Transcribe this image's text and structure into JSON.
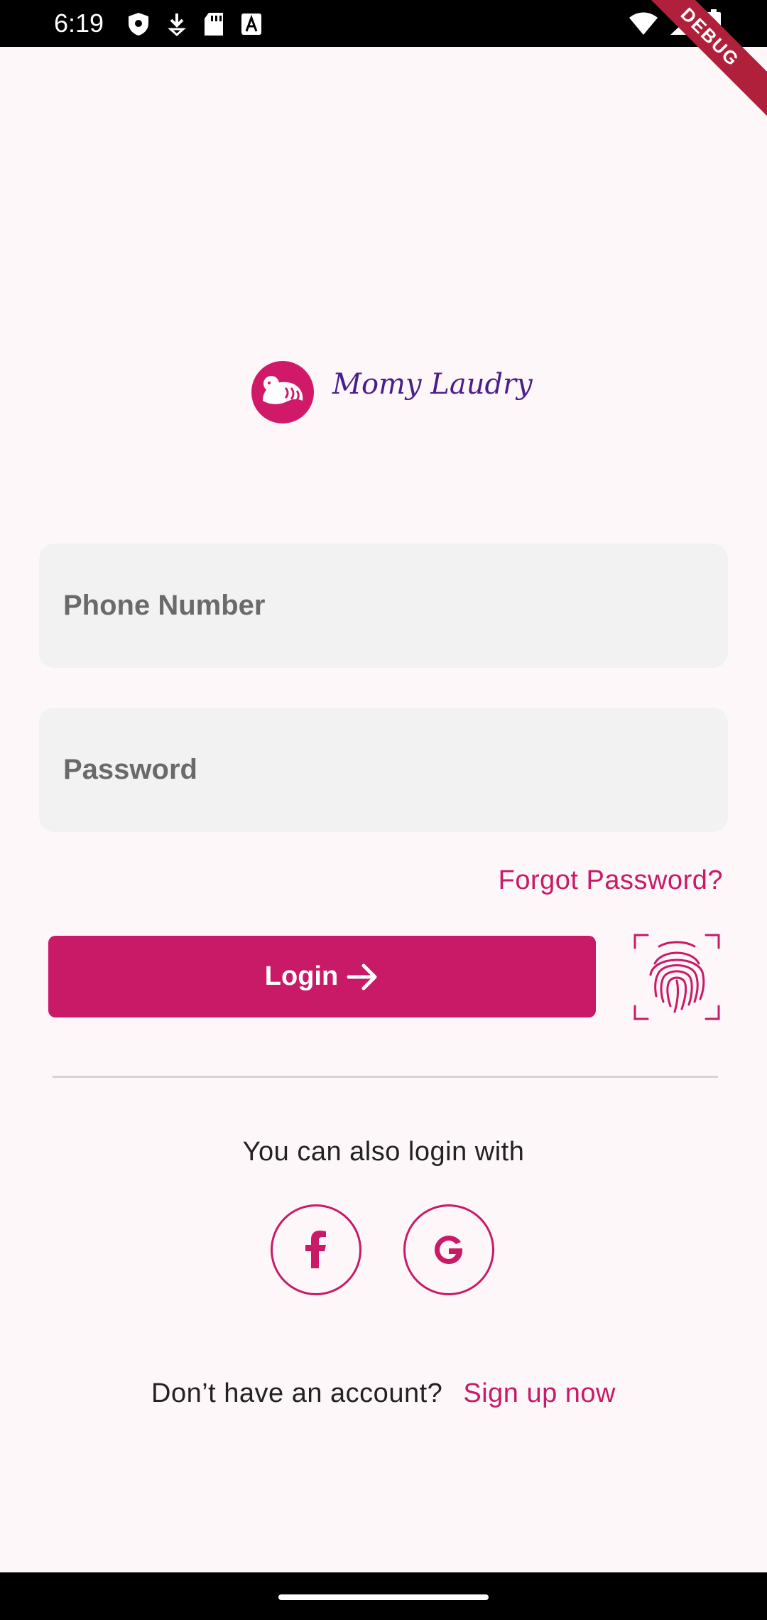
{
  "status_bar": {
    "time": "6:19",
    "left_icons": [
      "shield-icon",
      "download-icon",
      "sd-card-icon",
      "font-a-icon"
    ],
    "right_icons": [
      "wifi-icon",
      "signal-icon",
      "battery-icon"
    ]
  },
  "debug_ribbon": "DEBUG",
  "logo": {
    "text": "Momy Laudry",
    "mark_icon": "baby-icon"
  },
  "form": {
    "phone_placeholder": "Phone Number",
    "password_placeholder": "Password",
    "forgot_label": "Forgot Password?",
    "login_label": "Login",
    "login_icon": "arrow-right-icon",
    "biometric_icon": "fingerprint-icon"
  },
  "social": {
    "prompt": "You can also login with",
    "providers": [
      "facebook",
      "google"
    ]
  },
  "signup": {
    "question": "Don’t have an account?",
    "link": "Sign up now"
  },
  "colors": {
    "accent": "#C81A66",
    "background": "#FEF7FA",
    "field_bg": "#F2F2F2",
    "logo_text": "#4A1E8A"
  }
}
